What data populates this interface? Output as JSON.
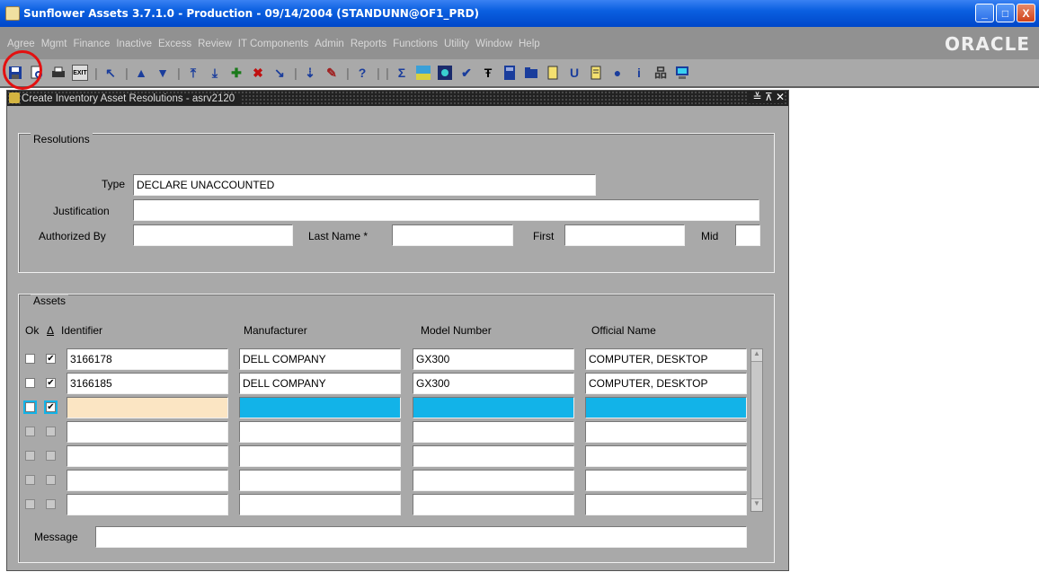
{
  "window": {
    "title": "Sunflower Assets 3.7.1.0 - Production - 09/14/2004 (STANDUNN@OF1_PRD)",
    "controls": [
      "_",
      "□",
      "X"
    ]
  },
  "menu": {
    "items": [
      "Agree",
      "Mgmt",
      "Finance",
      "Inactive",
      "Excess",
      "Review",
      "IT Components",
      "Admin",
      "Reports",
      "Functions",
      "Utility",
      "Window",
      "Help"
    ],
    "logo": "ORACLE"
  },
  "toolbar": {
    "icons": [
      "save-icon",
      "print-preview-icon",
      "print-icon",
      "exit-icon",
      "clear-icon",
      "prev-block-icon",
      "next-block-icon",
      "prev-record-icon",
      "next-record-icon",
      "insert-record-icon",
      "delete-record-icon",
      "lov-icon",
      "download-icon",
      "edit-icon",
      "help-icon",
      "sigma-icon",
      "image-icon",
      "calendar-icon",
      "check-icon",
      "text-icon",
      "calculator-icon",
      "folder-icon",
      "document-icon",
      "u-icon",
      "note-icon",
      "globe-icon",
      "info-icon",
      "network-icon",
      "monitor-icon"
    ],
    "exit_label": "EXIT"
  },
  "form": {
    "title": "Create Inventory Asset Resolutions - asrv2120",
    "controls": "≚ ⊼ ✕",
    "resolutions": {
      "group_label": "Resolutions",
      "type_label": "Type",
      "type_value": "DECLARE UNACCOUNTED",
      "justification_label": "Justification",
      "justification_value": "",
      "authorized_by_label": "Authorized By",
      "authorized_by_value": "",
      "last_name_label": "Last Name *",
      "last_name_value": "",
      "first_label": "First",
      "first_value": "",
      "mid_label": "Mid",
      "mid_value": ""
    },
    "assets": {
      "group_label": "Assets",
      "col_ok": "Ok",
      "col_delta": "Δ",
      "col_identifier": "Identifier",
      "col_manufacturer": "Manufacturer",
      "col_model": "Model Number",
      "col_official": "Official Name",
      "rows": [
        {
          "ok": false,
          "delta": true,
          "identifier": "3166178",
          "manufacturer": "DELL COMPANY",
          "model": "GX300",
          "official": "COMPUTER, DESKTOP"
        },
        {
          "ok": false,
          "delta": true,
          "identifier": "3166185",
          "manufacturer": "DELL COMPANY",
          "model": "GX300",
          "official": "COMPUTER, DESKTOP"
        },
        {
          "ok": false,
          "delta": true,
          "identifier": "",
          "manufacturer": "",
          "model": "",
          "official": ""
        },
        {
          "ok": false,
          "delta": false,
          "identifier": "",
          "manufacturer": "",
          "model": "",
          "official": ""
        },
        {
          "ok": false,
          "delta": false,
          "identifier": "",
          "manufacturer": "",
          "model": "",
          "official": ""
        },
        {
          "ok": false,
          "delta": false,
          "identifier": "",
          "manufacturer": "",
          "model": "",
          "official": ""
        },
        {
          "ok": false,
          "delta": false,
          "identifier": "",
          "manufacturer": "",
          "model": "",
          "official": ""
        },
        {
          "ok": false,
          "delta": false,
          "identifier": "",
          "manufacturer": "",
          "model": "",
          "official": ""
        }
      ]
    },
    "message_label": "Message",
    "message_value": ""
  }
}
